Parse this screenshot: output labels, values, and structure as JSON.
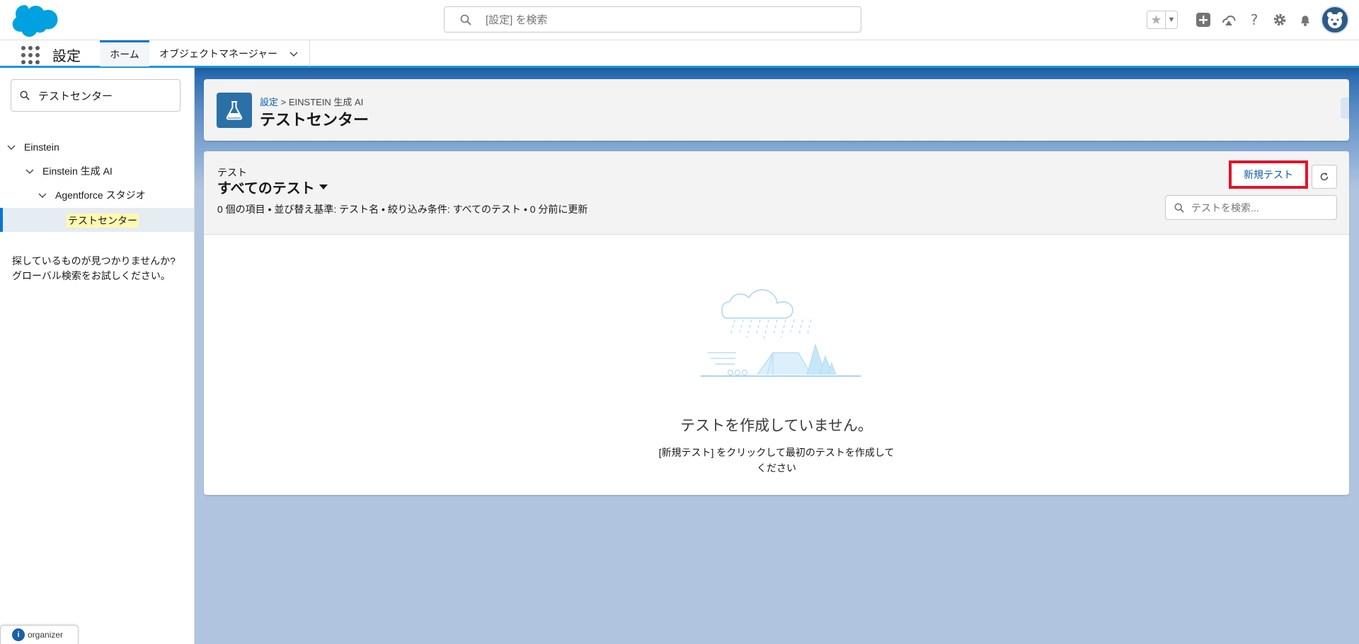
{
  "global_header": {
    "search_placeholder": "[設定] を検索"
  },
  "app_nav": {
    "app_name": "設定",
    "tabs": [
      {
        "label": "ホーム"
      },
      {
        "label": "オブジェクトマネージャー"
      }
    ]
  },
  "sidebar": {
    "quickfind_value": "テストセンター",
    "tree": [
      {
        "label": "Einstein"
      },
      {
        "label": "Einstein 生成 AI"
      },
      {
        "label": "Agentforce スタジオ"
      },
      {
        "label": "テストセンター"
      }
    ],
    "help_line1": "探しているものが見つかりませんか?",
    "help_line2": "グローバル検索をお試しください。",
    "organizer_label": "organizer"
  },
  "page_header": {
    "breadcrumb_link": "設定",
    "breadcrumb_sep": ">",
    "breadcrumb_current": "EINSTEIN 生成 AI",
    "title": "テストセンター"
  },
  "list": {
    "object_label": "テスト",
    "view_name": "すべてのテスト",
    "meta": "0 個の項目 • 並び替え基準: テスト名 • 絞り込み条件: すべてのテスト • 0 分前に更新",
    "new_button": "新規テスト",
    "search_placeholder": "テストを検索...",
    "empty_title": "テストを作成していません。",
    "empty_body_line1": "[新規テスト] をクリックして最初のテストを作成して",
    "empty_body_line2": "ください"
  },
  "colors": {
    "brand": "#0176d3",
    "highlight": "#e3122a",
    "content_bg": "#b0c4df"
  }
}
